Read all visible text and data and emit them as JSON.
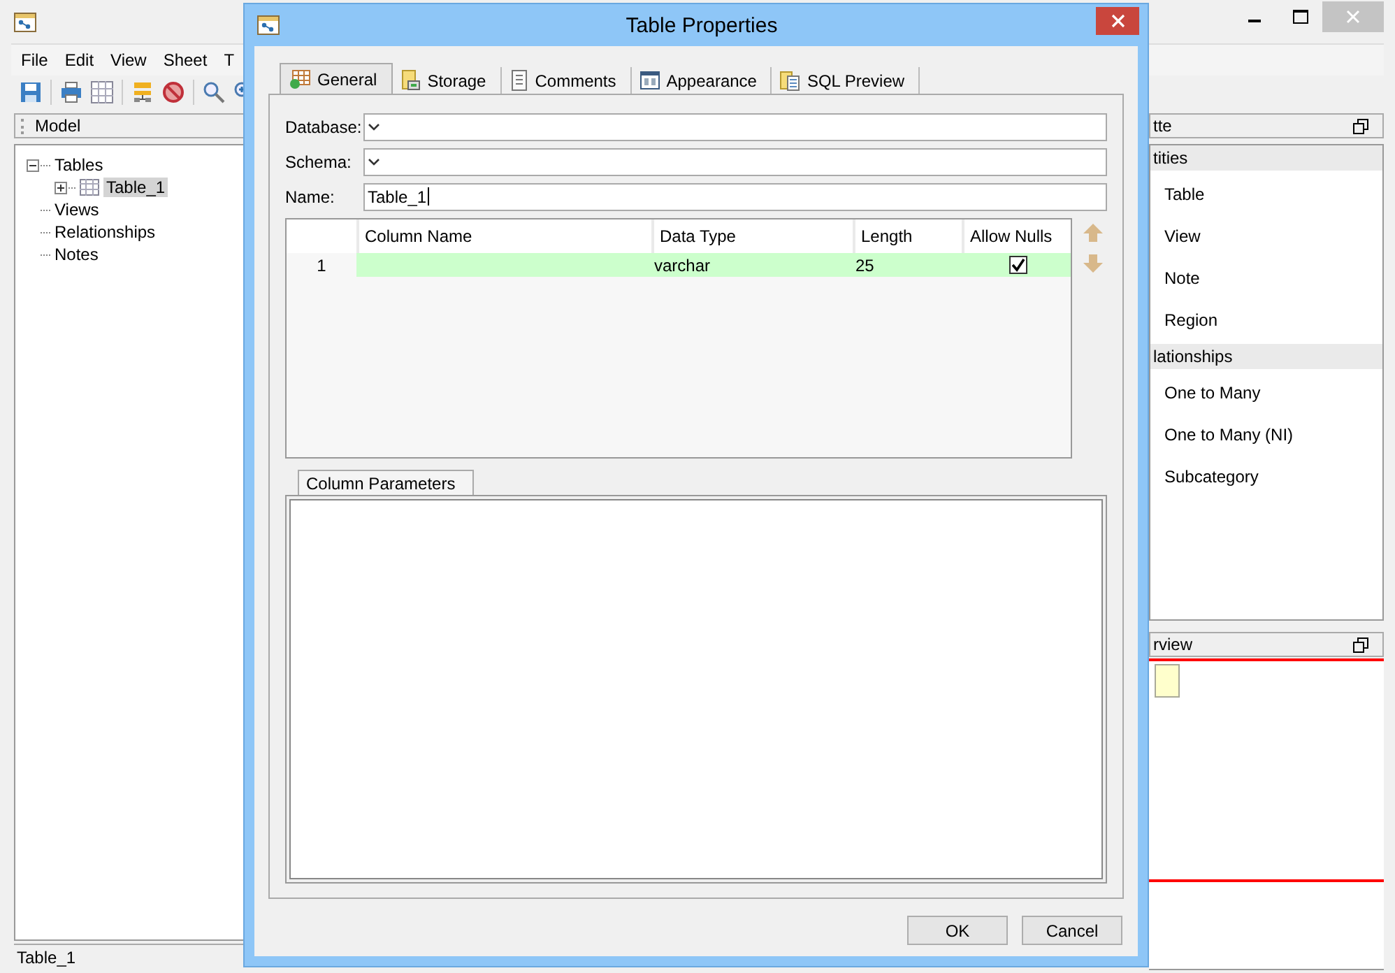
{
  "menu": [
    "File",
    "Edit",
    "View",
    "Sheet",
    "T"
  ],
  "model_panel": {
    "title": "Model",
    "tree": [
      {
        "label": "Tables",
        "expanded": true,
        "selected": false,
        "children": [
          {
            "label": "Table_1",
            "expanded": false,
            "selected": true
          }
        ]
      },
      {
        "label": "Views",
        "selected": false
      },
      {
        "label": "Relationships",
        "selected": false
      },
      {
        "label": "Notes",
        "selected": false
      }
    ]
  },
  "status_bar": "Table_1",
  "palette_panel": {
    "title": "tte",
    "sections": [
      {
        "title": "tities",
        "items": [
          "Table",
          "View",
          "Note",
          "Region"
        ]
      },
      {
        "title": "lationships",
        "items": [
          "One to Many",
          "One to Many (NI)",
          "Subcategory"
        ]
      }
    ]
  },
  "overview_panel": {
    "title": "rview"
  },
  "dialog": {
    "title": "Table Properties",
    "tabs": [
      {
        "label": "General",
        "selected": true
      },
      {
        "label": "Storage",
        "selected": false
      },
      {
        "label": "Comments",
        "selected": false
      },
      {
        "label": "Appearance",
        "selected": false
      },
      {
        "label": "SQL Preview",
        "selected": false
      }
    ],
    "fields": [
      {
        "label": "Database:",
        "kind": "dropdown"
      },
      {
        "label": "Schema:",
        "kind": "dropdown"
      },
      {
        "label": "Name:",
        "kind": "text",
        "value": "Table_1"
      }
    ],
    "columns_table": {
      "columns": [
        "Column Name",
        "Data Type",
        "Length",
        "Allow Nulls"
      ],
      "rows": [
        {
          "number": "1",
          "data_type": "varchar",
          "length": "25",
          "allow_nulls": true,
          "selected": true
        }
      ]
    },
    "subtabs": [
      {
        "label": "Column Parameters",
        "selected": true
      }
    ],
    "buttons": [
      "OK",
      "Cancel"
    ]
  }
}
